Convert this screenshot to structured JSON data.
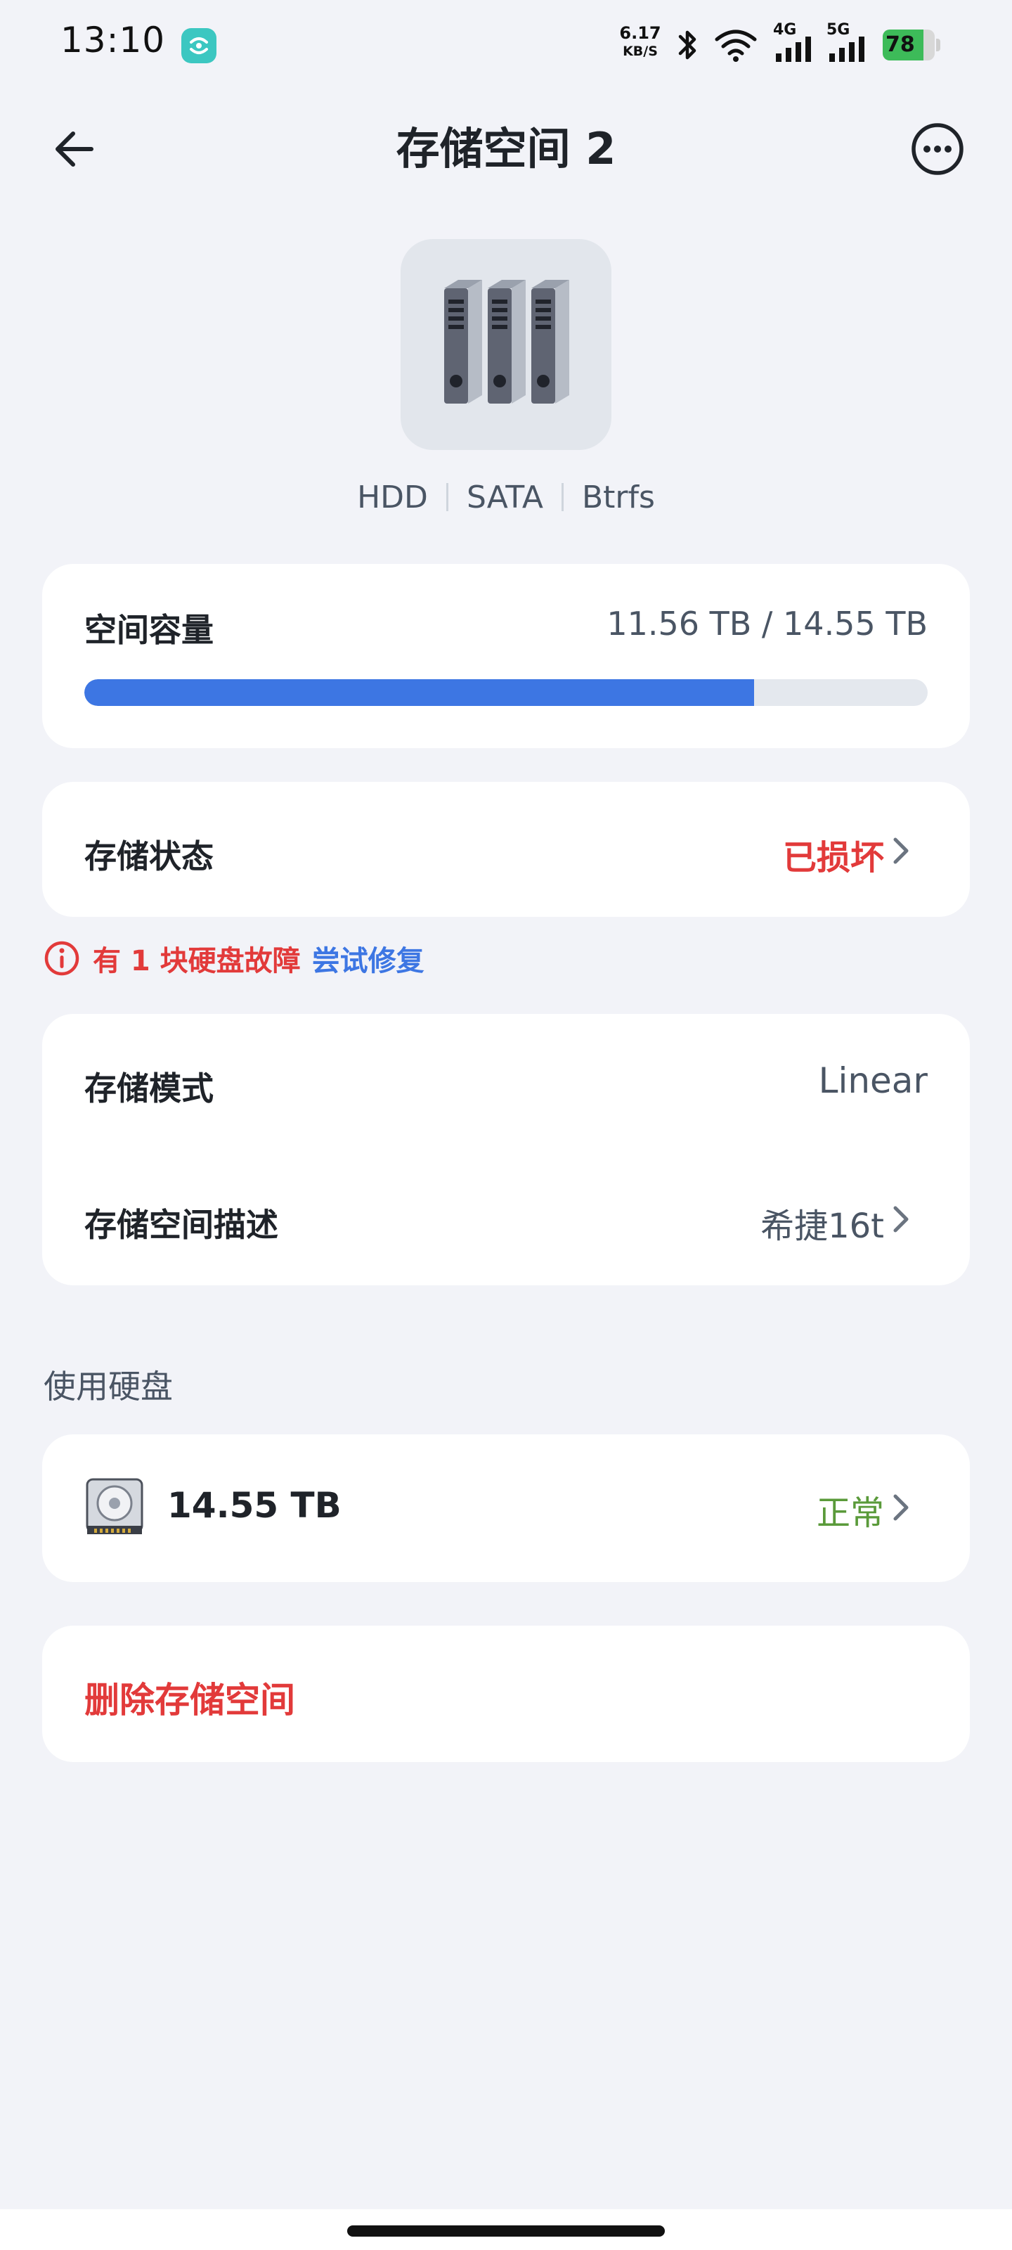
{
  "status_bar": {
    "time": "13:10",
    "net_speed": "6.17",
    "net_unit": "KB/S",
    "signal_4g": "4G",
    "signal_5g": "5G",
    "battery": "78",
    "battery_level_percent": 78,
    "icons": [
      "app-notification-icon",
      "bluetooth-icon",
      "wifi-icon",
      "cell-signal-4g-icon",
      "cell-signal-5g-icon",
      "battery-charging-icon"
    ]
  },
  "header": {
    "title": "存储空间 2",
    "back_icon": "arrow-left-icon",
    "more_icon": "more-horizontal-circle-icon"
  },
  "device": {
    "illustration_icon": "storage-drives-icon",
    "tags": [
      "HDD",
      "SATA",
      "Btrfs"
    ]
  },
  "capacity": {
    "label": "空间容量",
    "used_text": "11.56 TB",
    "separator": "/",
    "total_text": "14.55 TB",
    "usage_fraction": 0.7945
  },
  "storage_status": {
    "label": "存储状态",
    "value": "已损坏"
  },
  "warning": {
    "icon": "info-circle-icon",
    "text": "有 1 块硬盘故障",
    "action": "尝试修复"
  },
  "mode": {
    "label": "存储模式",
    "value": "Linear"
  },
  "description": {
    "label": "存储空间描述",
    "value": "希捷16t"
  },
  "disks_section": {
    "title": "使用硬盘",
    "items": [
      {
        "icon": "hard-disk-icon",
        "size": "14.55 TB",
        "status": "正常"
      }
    ]
  },
  "delete": {
    "label": "删除存储空间"
  },
  "colors": {
    "background": "#f2f3f8",
    "card": "#ffffff",
    "accent_blue": "#3d76e3",
    "error_red": "#e23a3a",
    "ok_green": "#5a9a3a",
    "text_primary": "#1f2329",
    "text_secondary": "#4a5564"
  }
}
